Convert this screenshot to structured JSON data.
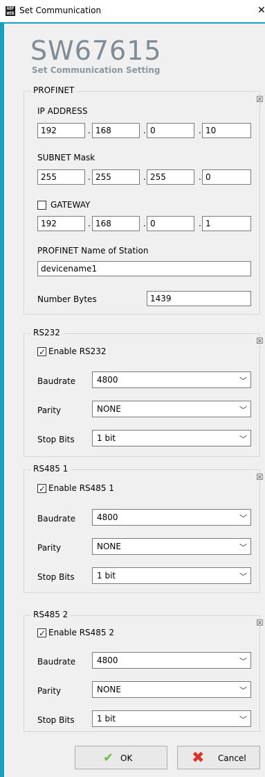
{
  "window": {
    "title": "Set Communication",
    "app_icon_text": "ADF WEB"
  },
  "header": {
    "product_code": "SW67615",
    "subtitle": "Set Communication Setting"
  },
  "profinet": {
    "legend": "PROFINET",
    "ip_label": "IP ADDRESS",
    "ip": [
      "192",
      "168",
      "0",
      "10"
    ],
    "subnet_label": "SUBNET Mask",
    "subnet": [
      "255",
      "255",
      "255",
      "0"
    ],
    "gateway_label": "GATEWAY",
    "gateway_checked": false,
    "gateway": [
      "192",
      "168",
      "0",
      "1"
    ],
    "station_label": "PROFINET Name of Station",
    "station_value": "devicename1",
    "nbytes_label": "Number Bytes",
    "nbytes_value": "1439"
  },
  "rs232": {
    "legend": "RS232",
    "enable_label": "Enable RS232",
    "enabled": true,
    "baudrate_label": "Baudrate",
    "baudrate": "4800",
    "parity_label": "Parity",
    "parity": "NONE",
    "stopbits_label": "Stop Bits",
    "stopbits": "1 bit"
  },
  "rs485_1": {
    "legend": "RS485 1",
    "enable_label": "Enable RS485 1",
    "enabled": true,
    "baudrate_label": "Baudrate",
    "baudrate": "4800",
    "parity_label": "Parity",
    "parity": "NONE",
    "stopbits_label": "Stop Bits",
    "stopbits": "1 bit"
  },
  "rs485_2": {
    "legend": "RS485 2",
    "enable_label": "Enable RS485 2",
    "enabled": true,
    "baudrate_label": "Baudrate",
    "baudrate": "4800",
    "parity_label": "Parity",
    "parity": "NONE",
    "stopbits_label": "Stop Bits",
    "stopbits": "1 bit"
  },
  "buttons": {
    "ok": "OK",
    "cancel": "Cancel"
  },
  "icons": {
    "close": "close-icon",
    "ok": "checkmark-icon",
    "cancel": "red-x-icon",
    "collapse": "collapse-x-icon",
    "dropdown": "chevron-down-icon"
  },
  "colors": {
    "accent": "#17a0bf",
    "title_gray": "#7f8c96",
    "ok_green": "#6cbf3a",
    "cancel_red": "#e0312b"
  }
}
